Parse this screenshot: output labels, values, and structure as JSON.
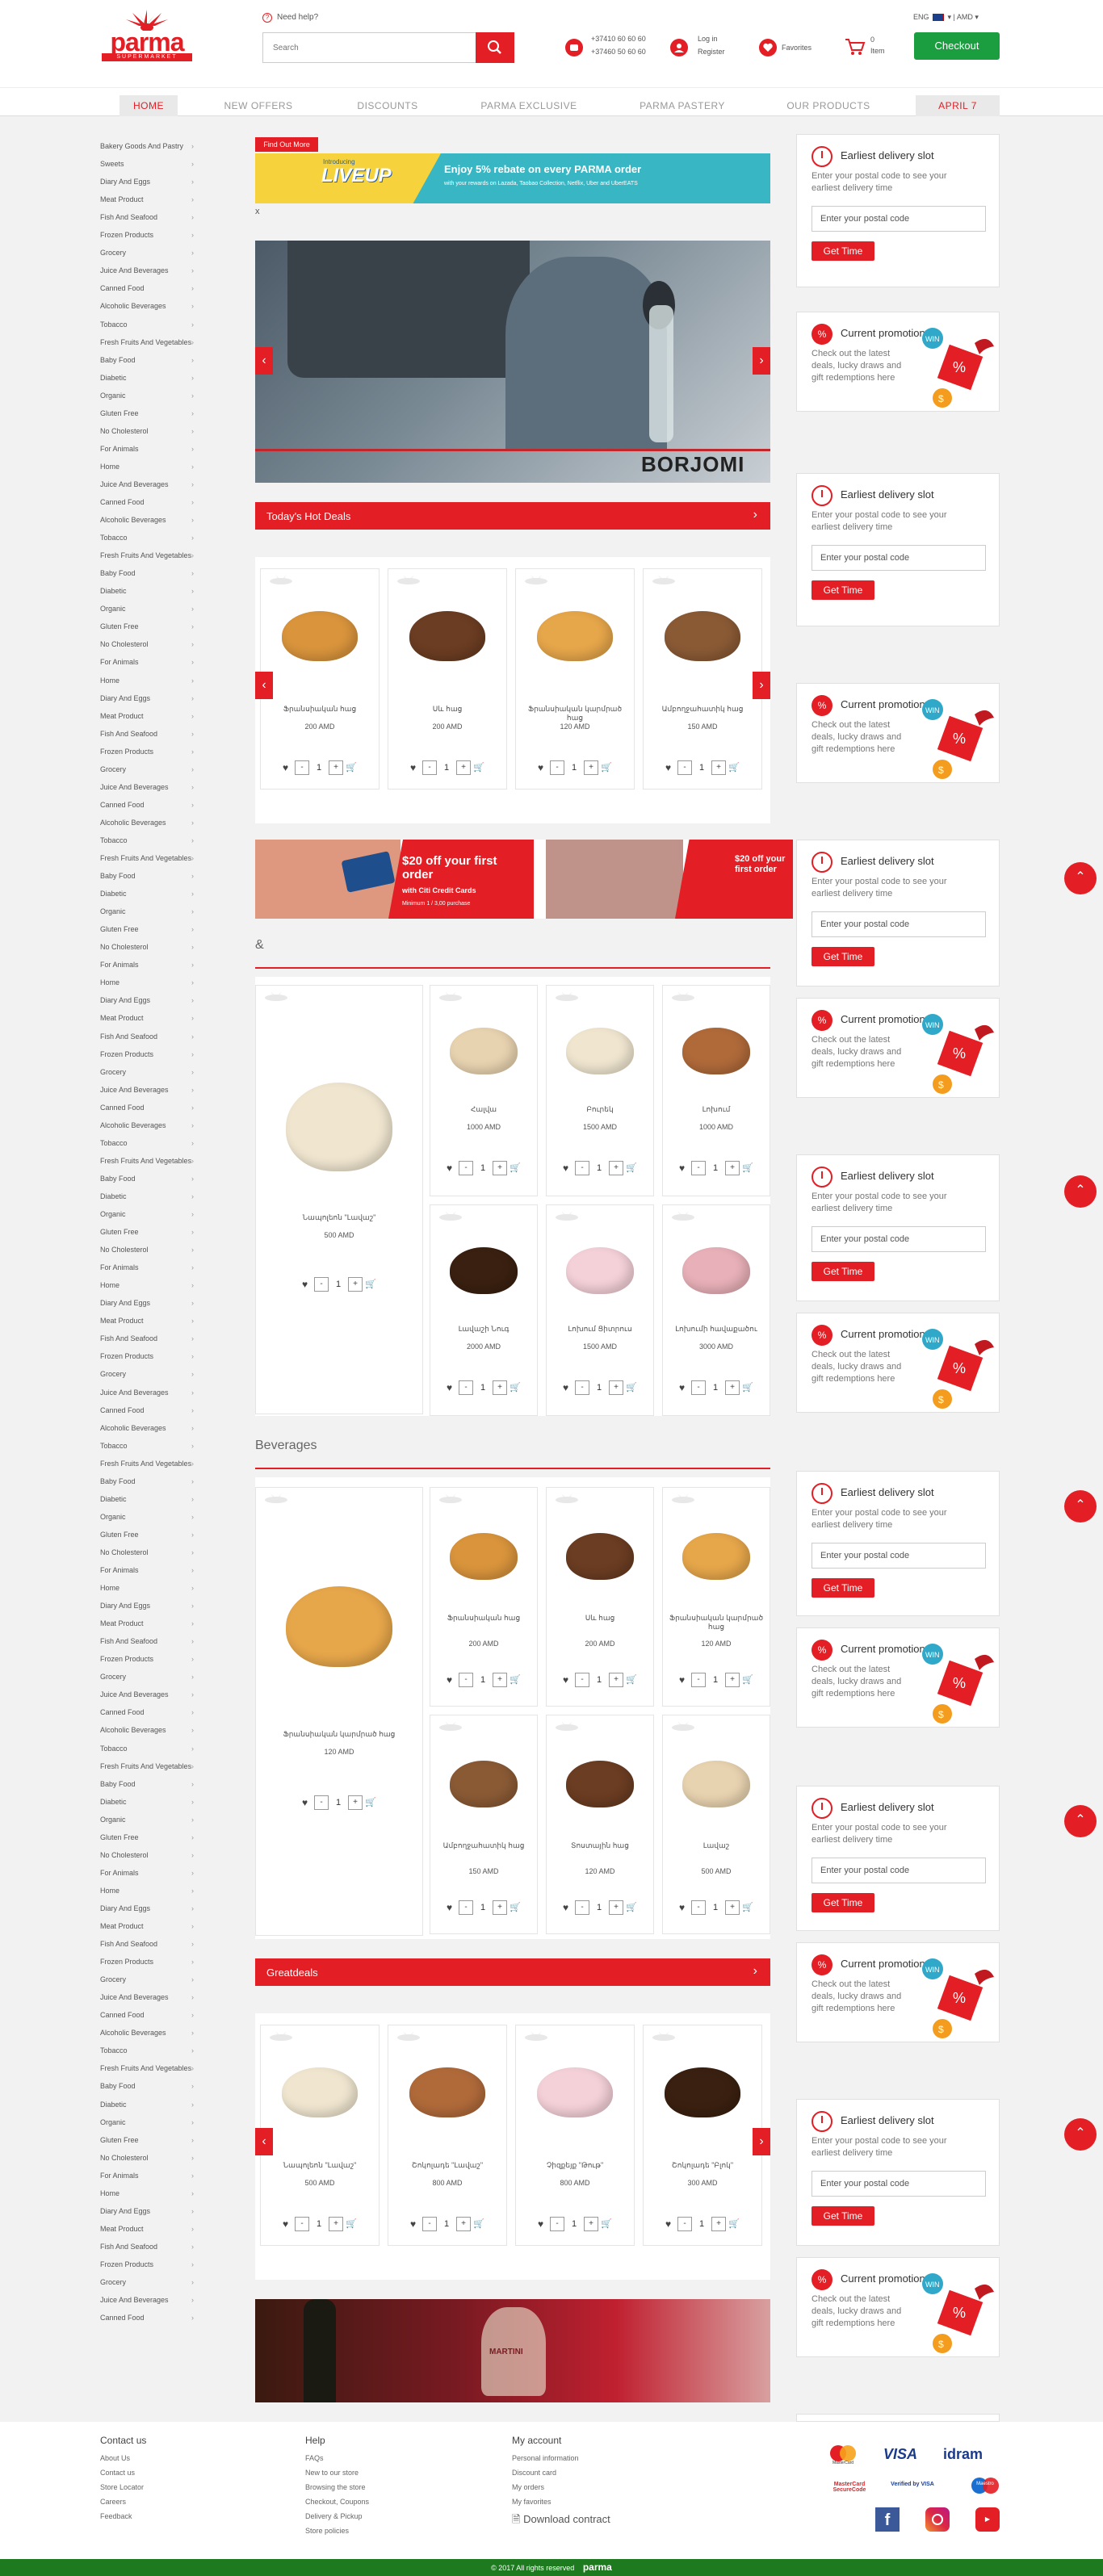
{
  "header": {
    "need_help": "Need help?",
    "search_placeholder": "Search",
    "phone1": "+37410 60 60 60",
    "phone2": "+37460 50 60 60",
    "login": "Log in",
    "register": "Register",
    "favorites": "Favorites",
    "cart_count": "0",
    "cart_label": "Item",
    "lang": "ENG",
    "currency": "AMD",
    "checkout": "Checkout",
    "logo_text": "parma",
    "logo_sub": "SUPERMARKET"
  },
  "nav": [
    "HOME",
    "NEW OFFERS",
    "DISCOUNTS",
    "PARMA EXCLUSIVE",
    "PARMA PASTERY",
    "OUR PRODUCTS",
    "APRIL 7"
  ],
  "sidebar_categories": [
    "Bakery Goods And Pastry",
    "Sweets",
    "Diary And Eggs",
    "Meat Product",
    "Fish And Seafood",
    "Frozen Products",
    "Grocery",
    "Juice And Beverages",
    "Canned Food",
    "Alcoholic Beverages",
    "Tobacco",
    "Fresh Fruits And Vegetables",
    "Baby Food",
    "Diabetic",
    "Organic",
    "Gluten Free",
    "No Cholesterol",
    "For Animals",
    "Home",
    "Juice And Beverages",
    "Canned Food",
    "Alcoholic Beverages",
    "Tobacco",
    "Fresh Fruits And Vegetables",
    "Baby Food",
    "Diabetic",
    "Organic",
    "Gluten Free",
    "No Cholesterol",
    "For Animals",
    "Home",
    "Diary And Eggs",
    "Meat Product",
    "Fish And Seafood",
    "Frozen Products",
    "Grocery",
    "Juice And Beverages",
    "Canned Food",
    "Alcoholic Beverages",
    "Tobacco",
    "Fresh Fruits And Vegetables",
    "Baby Food",
    "Diabetic",
    "Organic",
    "Gluten Free",
    "No Cholesterol",
    "For Animals",
    "Home",
    "Diary And Eggs",
    "Meat Product",
    "Fish And Seafood",
    "Frozen Products",
    "Grocery",
    "Juice And Beverages",
    "Canned Food",
    "Alcoholic Beverages",
    "Tobacco",
    "Fresh Fruits And Vegetables",
    "Baby Food",
    "Diabetic",
    "Organic",
    "Gluten Free",
    "No Cholesterol",
    "For Animals",
    "Home",
    "Diary And Eggs",
    "Meat Product",
    "Fish And Seafood",
    "Frozen Products",
    "Grocery",
    "Juice And Beverages",
    "Canned Food",
    "Alcoholic Beverages",
    "Tobacco",
    "Fresh Fruits And Vegetables",
    "Baby Food",
    "Diabetic",
    "Organic",
    "Gluten Free",
    "No Cholesterol",
    "For Animals",
    "Home",
    "Diary And Eggs",
    "Meat Product",
    "Fish And Seafood",
    "Frozen Products",
    "Grocery",
    "Juice And Beverages",
    "Canned Food",
    "Alcoholic Beverages",
    "Tobacco",
    "Fresh Fruits And Vegetables",
    "Baby Food",
    "Diabetic",
    "Organic",
    "Gluten Free",
    "No Cholesterol",
    "For Animals",
    "Home",
    "Diary And Eggs",
    "Meat Product",
    "Fish And Seafood",
    "Frozen Products",
    "Grocery",
    "Juice And Beverages",
    "Canned Food",
    "Alcoholic Beverages",
    "Tobacco",
    "Fresh Fruits And Vegetables",
    "Baby Food",
    "Diabetic",
    "Organic",
    "Gluten Free",
    "No Cholesterol",
    "For Animals",
    "Home",
    "Diary And Eggs",
    "Meat Product",
    "Fish And Seafood",
    "Frozen Products",
    "Grocery",
    "Juice And Beverages",
    "Canned Food"
  ],
  "promo_banner": {
    "find_out": "Find Out More",
    "liveup": "LIVEUP",
    "liveup_intro": "Introducing",
    "text": "Enjoy 5% rebate on every PARMA order",
    "subtext": "with your rewards on Lazada, Taobao Collection, Netflix, Uber and UberEATS"
  },
  "close_x": "x",
  "hero_brand": "BORJOMI",
  "todays_hot_deals": "Today's Hot Deals",
  "hot_deals": [
    {
      "name": "Ֆրանսիական հաց",
      "price": "200 AMD"
    },
    {
      "name": "Սև հաց",
      "price": "200 AMD"
    },
    {
      "name": "Ֆրանսիական կարմրած հաց",
      "price": "120 AMD"
    },
    {
      "name": "Ամբողջահատիկ հաց",
      "price": "150 AMD"
    }
  ],
  "citi_banner": {
    "headline": "$20 off your first order",
    "sub": "with Citi Credit Cards",
    "note": "Minimum 1 / 3,00 purchase"
  },
  "amp_title": "&",
  "amp_featured": {
    "name": "Նապոլեոն \"Լավաշ\"",
    "price": "500 AMD"
  },
  "amp_products": [
    {
      "name": "Հալվա",
      "price": "1000 AMD"
    },
    {
      "name": "Բուրեկ",
      "price": "1500 AMD"
    },
    {
      "name": "Լոխում",
      "price": "1000 AMD"
    },
    {
      "name": "Լավաշի Նուգ",
      "price": "2000 AMD"
    },
    {
      "name": "Լոխում Ցիտրուս",
      "price": "1500 AMD"
    },
    {
      "name": "Լոխումի հավաքածու",
      "price": "3000 AMD"
    }
  ],
  "beverages_title": "Beverages",
  "bev_featured": {
    "name": "Ֆրանսիական կարմրած հաց",
    "price": "120 AMD"
  },
  "bev_products": [
    {
      "name": "Ֆրանսիական հաց",
      "price": "200 AMD"
    },
    {
      "name": "Սև հաց",
      "price": "200 AMD"
    },
    {
      "name": "Ֆրանսիական կարմրած հաց",
      "price": "120 AMD"
    },
    {
      "name": "Ամբողջահատիկ հաց",
      "price": "150 AMD"
    },
    {
      "name": "Տոստային հաց",
      "price": "120 AMD"
    },
    {
      "name": "Լավաշ",
      "price": "500 AMD"
    }
  ],
  "greatdeals": "Greatdeals",
  "great_products": [
    {
      "name": "Նապոլեոն \"Լավաշ\"",
      "price": "500 AMD"
    },
    {
      "name": "Շոկոլադե \"Լավաշ\"",
      "price": "800 AMD"
    },
    {
      "name": "Չիզքեյք \"Թութ\"",
      "price": "800 AMD"
    },
    {
      "name": "Շոկոլադե \"Բլոկ\"",
      "price": "300 AMD"
    }
  ],
  "hero2_brand": "MARTINI",
  "qty_default": "1",
  "widgets": {
    "delivery_title": "Earliest delivery slot",
    "delivery_desc": "Enter your postal code to see your earliest delivery time",
    "postal_placeholder": "Enter your postal code",
    "get_time": "Get Time",
    "promo_title": "Current promotions",
    "promo_desc": "Check out the latest deals, lucky draws and gift redemptions here"
  },
  "footer": {
    "contact_title": "Contact us",
    "contact_links": [
      "About Us",
      "Contact us",
      "Store Locator",
      "Careers",
      "Feedback"
    ],
    "help_title": "Help",
    "help_links": [
      "FAQs",
      "New to our store",
      "Browsing the store",
      "Checkout, Coupons",
      "Delivery & Pickup",
      "Store policies"
    ],
    "account_title": "My account",
    "account_links": [
      "Personal information",
      "Discount card",
      "My orders",
      "My favorites"
    ],
    "download": "Download contract",
    "payment": [
      "MasterCard",
      "VISA",
      "idram",
      "MasterCard SecureCode",
      "Verified by VISA",
      "Maestro"
    ]
  },
  "copyright": "© 2017 All rights reserved",
  "colors": {
    "brand_red": "#e31e24",
    "green": "#1a9e3f",
    "footer_green": "#1d7a1e"
  }
}
